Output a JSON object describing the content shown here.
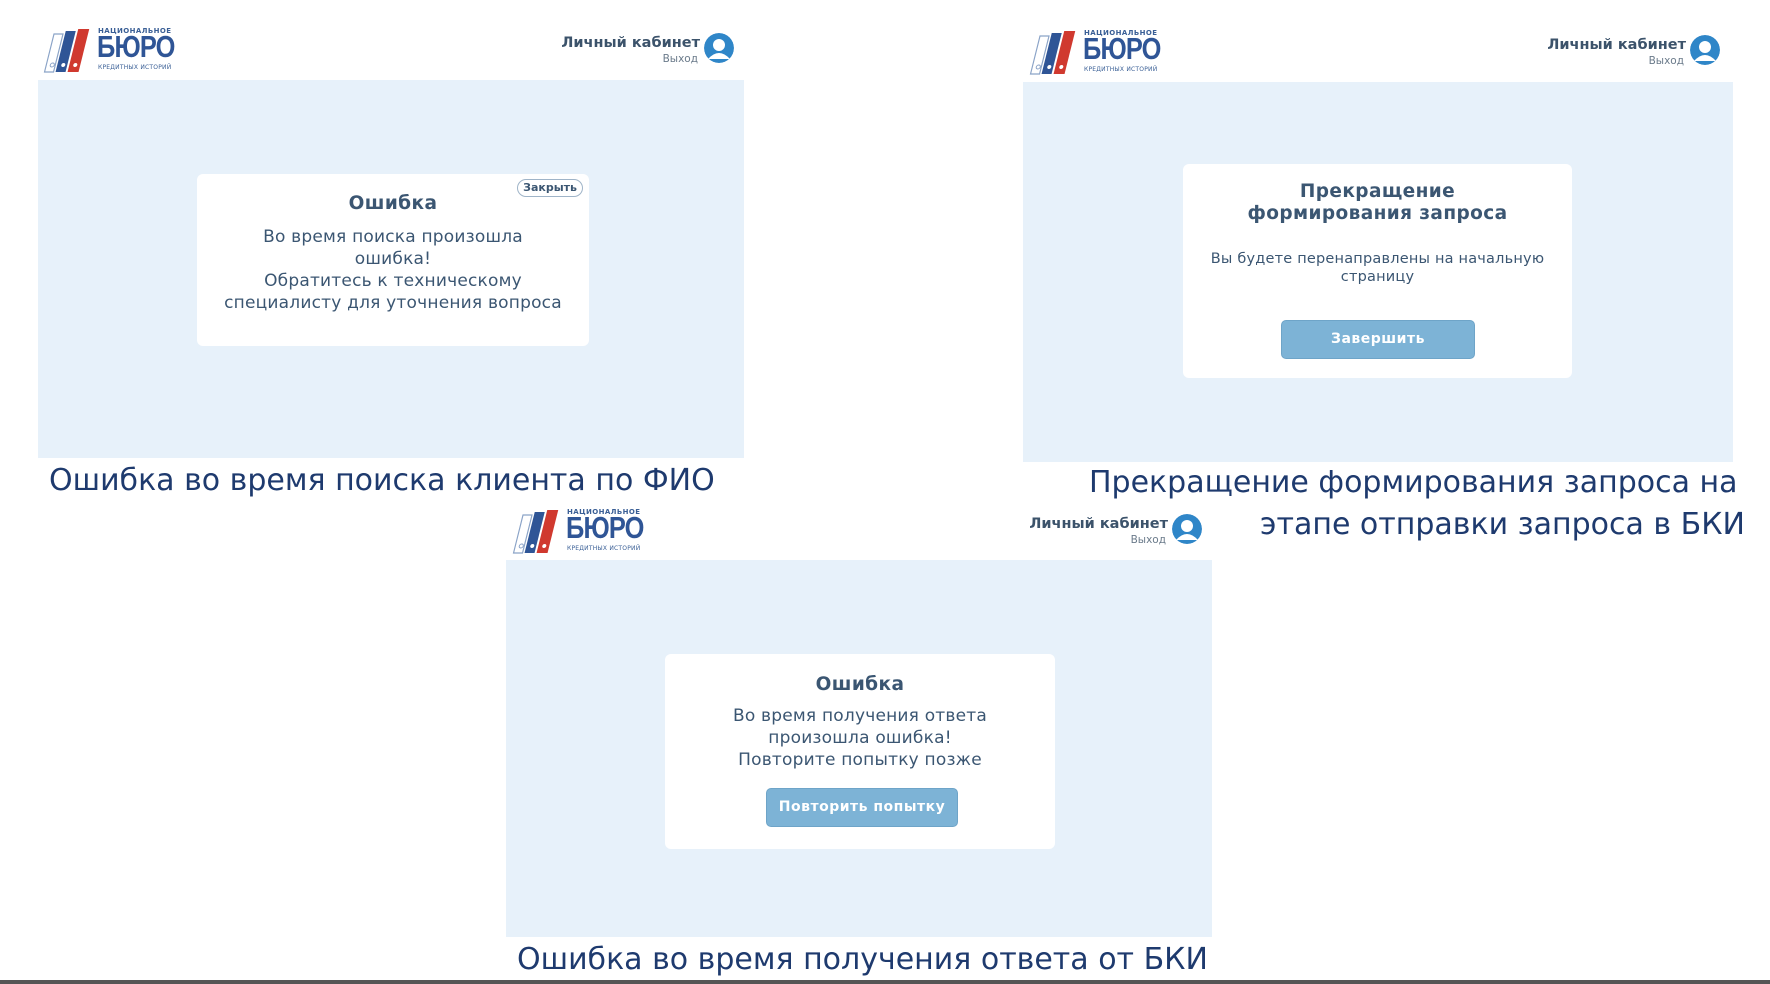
{
  "logo": {
    "top_text": "НАЦИОНАЛЬНОЕ",
    "main_text": "БЮРО",
    "bottom_text": "КРЕДИТНЫХ ИСТОРИЙ"
  },
  "user": {
    "name": "Личный кабинет",
    "exit": "Выход"
  },
  "screens": [
    {
      "modal": {
        "close_label": "Закрыть",
        "title": "Ошибка",
        "text": "Во время поиска произошла\nошибка!\nОбратитесь к техническому\nспециалисту для уточнения вопроса"
      },
      "caption": "Ошибка во время поиска клиента по ФИО"
    },
    {
      "modal": {
        "title": "Прекращение\nформирования запроса",
        "text": "Вы будете перенаправлены на начальную страницу",
        "button": "Завершить"
      },
      "caption_line1": "Прекращение формирования запроса на",
      "caption_line2": "этапе отправки запроса в БКИ"
    },
    {
      "modal": {
        "title": "Ошибка",
        "text": "Во время получения ответа\nпроизошла ошибка!\nПовторите попытку позже",
        "button": "Повторить попытку"
      },
      "caption": "Ошибка во время получения ответа от БКИ"
    }
  ],
  "colors": {
    "stage_bg": "#e7f1fa",
    "button_bg": "#7db3d6",
    "caption": "#1e3a6e",
    "logo_blue": "#2f5596",
    "logo_red": "#d0392f"
  },
  "icons": [
    "logo-books-icon",
    "user-avatar-icon"
  ]
}
